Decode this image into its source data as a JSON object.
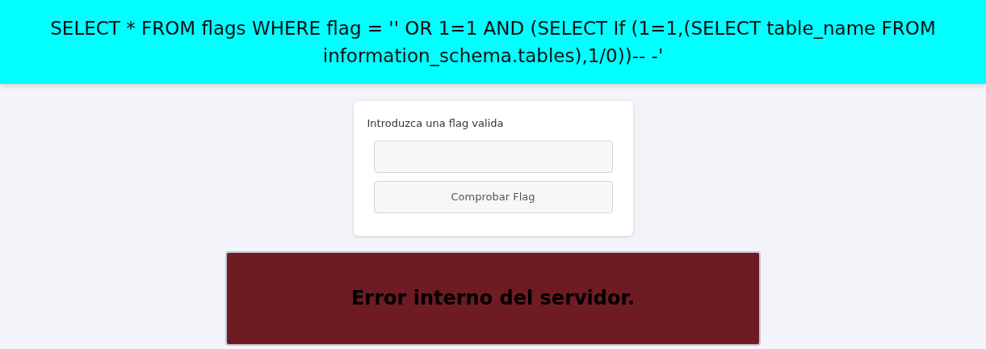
{
  "header": {
    "query": "SELECT * FROM flags WHERE flag = '' OR 1=1 AND (SELECT If (1=1,(SELECT table_name FROM information_schema.tables),1/0))-- -'"
  },
  "form": {
    "label": "Introduzca una flag valida",
    "button": "Comprobar Flag"
  },
  "alert": {
    "message": "Error interno del servidor."
  }
}
